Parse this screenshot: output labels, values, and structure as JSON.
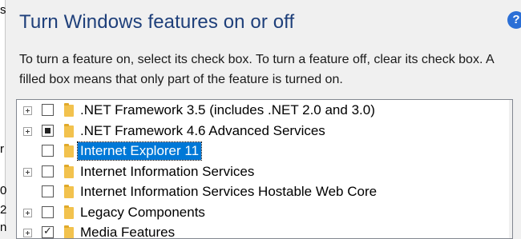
{
  "window": {
    "title": "Turn Windows features on or off",
    "help_icon": "?",
    "left_edge_fragments": [
      "s",
      "r",
      "0",
      "2",
      "n"
    ]
  },
  "description": "To turn a feature on, select its check box. To turn a feature off, clear its check box. A filled box means that only part of the feature is turned on.",
  "features": [
    {
      "label": ".NET Framework 3.5 (includes .NET 2.0 and 3.0)",
      "expandable": true,
      "state": "unchecked",
      "selected": false
    },
    {
      "label": ".NET Framework 4.6 Advanced Services",
      "expandable": true,
      "state": "partial",
      "selected": false
    },
    {
      "label": "Internet Explorer 11",
      "expandable": false,
      "state": "unchecked",
      "selected": true
    },
    {
      "label": "Internet Information Services",
      "expandable": true,
      "state": "unchecked",
      "selected": false
    },
    {
      "label": "Internet Information Services Hostable Web Core",
      "expandable": false,
      "state": "unchecked",
      "selected": false
    },
    {
      "label": "Legacy Components",
      "expandable": true,
      "state": "unchecked",
      "selected": false
    },
    {
      "label": "Media Features",
      "expandable": true,
      "state": "checked",
      "selected": false
    }
  ],
  "colors": {
    "title": "#1e3f7a",
    "selection": "#0078d7",
    "folder": "#f2c24e"
  },
  "icons": {
    "help": "help-icon",
    "expander": "plus-expander-icon",
    "folder": "folder-icon"
  }
}
